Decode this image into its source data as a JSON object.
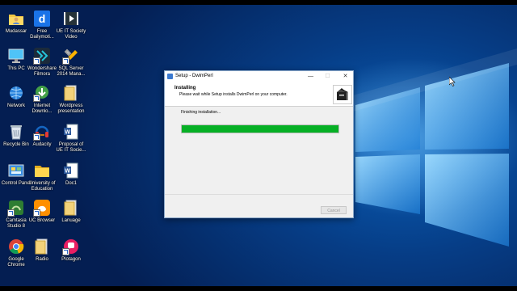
{
  "desktop": {
    "icons": [
      {
        "label": "Mudassar",
        "icon": "folder-user-icon"
      },
      {
        "label": "Free Dailymoti...",
        "icon": "dailymotion-icon"
      },
      {
        "label": "UE IT Society Video",
        "icon": "video-file-icon"
      },
      {
        "label": "This PC",
        "icon": "this-pc-icon"
      },
      {
        "label": "Wondershare Filmora",
        "icon": "filmora-icon"
      },
      {
        "label": "SQL Server 2014 Mana...",
        "icon": "sql-server-icon"
      },
      {
        "label": "Network",
        "icon": "network-icon"
      },
      {
        "label": "Internet Downlo...",
        "icon": "internet-download-manager-icon"
      },
      {
        "label": "Wordpress presentation",
        "icon": "folder-icon"
      },
      {
        "label": "Recycle Bin",
        "icon": "recycle-bin-icon"
      },
      {
        "label": "Audacity",
        "icon": "audacity-icon"
      },
      {
        "label": "Proposal of UE IT Socie...",
        "icon": "word-doc-icon"
      },
      {
        "label": "Control Panel",
        "icon": "control-panel-icon"
      },
      {
        "label": "University of Education",
        "icon": "folder-icon"
      },
      {
        "label": "Doc1",
        "icon": "word-doc-icon"
      },
      {
        "label": "Camtasia Studio 8",
        "icon": "camtasia-icon"
      },
      {
        "label": "UC Browser",
        "icon": "uc-browser-icon"
      },
      {
        "label": "Lanuage",
        "icon": "folder-icon"
      },
      {
        "label": "Google Chrome",
        "icon": "chrome-icon"
      },
      {
        "label": "Radio",
        "icon": "folder-icon"
      },
      {
        "label": "Plotagon",
        "icon": "plotagon-icon"
      }
    ]
  },
  "dialog": {
    "title": "Setup - DwimPerl",
    "heading": "Installing",
    "subheading": "Please wait while Setup installs DwimPerl on your computer.",
    "status": "Finishing installation...",
    "progress_percent": 100,
    "cancel_label": "Cancel",
    "minimize_glyph": "—",
    "maximize_glyph": "☐",
    "close_glyph": "✕"
  },
  "colors": {
    "progress": "#06b025",
    "desktop_blue": "#063d86",
    "accent": "#3c7ad0"
  }
}
